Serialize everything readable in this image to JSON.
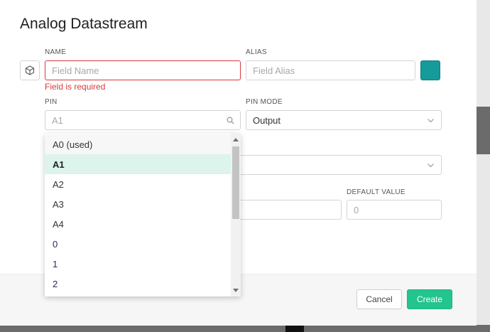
{
  "modal": {
    "title": "Analog Datastream"
  },
  "name": {
    "label": "NAME",
    "placeholder": "Field Name",
    "error": "Field is required"
  },
  "alias": {
    "label": "ALIAS",
    "placeholder": "Field Alias",
    "color": "#169b9b"
  },
  "pin": {
    "label": "PIN",
    "value": "A1"
  },
  "pin_mode": {
    "label": "PIN MODE",
    "value": "Output"
  },
  "default_value": {
    "label": "DEFAULT VALUE",
    "value": "0"
  },
  "pin_options": [
    {
      "label": "A0 (used)",
      "state": "used"
    },
    {
      "label": "A1",
      "state": "selected"
    },
    {
      "label": "A2",
      "state": "normal"
    },
    {
      "label": "A3",
      "state": "normal"
    },
    {
      "label": "A4",
      "state": "normal"
    },
    {
      "label": "0",
      "state": "normal"
    },
    {
      "label": "1",
      "state": "normal"
    },
    {
      "label": "2",
      "state": "normal"
    }
  ],
  "footer": {
    "cancel_label": "Cancel",
    "create_label": "Create"
  },
  "colors": {
    "accent": "#23c48e",
    "error": "#d93a3a",
    "selected_row": "#dcf4ec"
  }
}
